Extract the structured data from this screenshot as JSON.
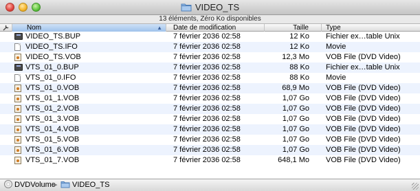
{
  "window": {
    "title": "VIDEO_TS",
    "status": "13 éléments, Zéro Ko disponibles"
  },
  "columns": {
    "name": "Nom",
    "date": "Date de modification",
    "size": "Taille",
    "kind": "Type"
  },
  "files": [
    {
      "name": "VIDEO_TS.BUP",
      "date": "7 février 2036 02:58",
      "size": "12 Ko",
      "kind": "Fichier ex…table Unix",
      "icon": "executable-file-icon"
    },
    {
      "name": "VIDEO_TS.IFO",
      "date": "7 février 2036 02:58",
      "size": "12 Ko",
      "kind": "Movie",
      "icon": "document-file-icon"
    },
    {
      "name": "VIDEO_TS.VOB",
      "date": "7 février 2036 02:58",
      "size": "12,3 Mo",
      "kind": "VOB File (DVD Video)",
      "icon": "vob-file-icon"
    },
    {
      "name": "VTS_01_0.BUP",
      "date": "7 février 2036 02:58",
      "size": "88 Ko",
      "kind": "Fichier ex…table Unix",
      "icon": "executable-file-icon"
    },
    {
      "name": "VTS_01_0.IFO",
      "date": "7 février 2036 02:58",
      "size": "88 Ko",
      "kind": "Movie",
      "icon": "document-file-icon"
    },
    {
      "name": "VTS_01_0.VOB",
      "date": "7 février 2036 02:58",
      "size": "68,9 Mo",
      "kind": "VOB File (DVD Video)",
      "icon": "vob-file-icon"
    },
    {
      "name": "VTS_01_1.VOB",
      "date": "7 février 2036 02:58",
      "size": "1,07 Go",
      "kind": "VOB File (DVD Video)",
      "icon": "vob-file-icon"
    },
    {
      "name": "VTS_01_2.VOB",
      "date": "7 février 2036 02:58",
      "size": "1,07 Go",
      "kind": "VOB File (DVD Video)",
      "icon": "vob-file-icon"
    },
    {
      "name": "VTS_01_3.VOB",
      "date": "7 février 2036 02:58",
      "size": "1,07 Go",
      "kind": "VOB File (DVD Video)",
      "icon": "vob-file-icon"
    },
    {
      "name": "VTS_01_4.VOB",
      "date": "7 février 2036 02:58",
      "size": "1,07 Go",
      "kind": "VOB File (DVD Video)",
      "icon": "vob-file-icon"
    },
    {
      "name": "VTS_01_5.VOB",
      "date": "7 février 2036 02:58",
      "size": "1,07 Go",
      "kind": "VOB File (DVD Video)",
      "icon": "vob-file-icon"
    },
    {
      "name": "VTS_01_6.VOB",
      "date": "7 février 2036 02:58",
      "size": "1,07 Go",
      "kind": "VOB File (DVD Video)",
      "icon": "vob-file-icon"
    },
    {
      "name": "VTS_01_7.VOB",
      "date": "7 février 2036 02:58",
      "size": "648,1 Mo",
      "kind": "VOB File (DVD Video)",
      "icon": "vob-file-icon"
    }
  ],
  "pathbar": {
    "volume": "DVDVolume",
    "folder": "VIDEO_TS"
  },
  "colors": {
    "selected_header": "#9fc2ec",
    "alternate_row": "#edf3fe"
  }
}
